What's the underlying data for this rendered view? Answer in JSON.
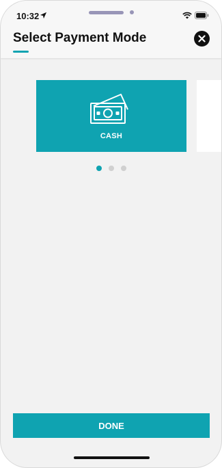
{
  "status_bar": {
    "time": "10:32",
    "icons": [
      "location-arrow-icon",
      "wifi-icon",
      "battery-icon"
    ]
  },
  "header": {
    "title": "Select Payment Mode",
    "close_icon": "close-icon"
  },
  "carousel": {
    "cards": [
      {
        "label": "CASH",
        "icon": "cash-icon"
      },
      {
        "label": "",
        "icon": ""
      }
    ],
    "pages": 3,
    "active_page": 1
  },
  "footer": {
    "done_label": "DONE"
  },
  "colors": {
    "accent": "#0fa3b1",
    "background": "#f2f2f2",
    "dot_inactive": "#d0d0d0",
    "notch": "#9895b7"
  }
}
